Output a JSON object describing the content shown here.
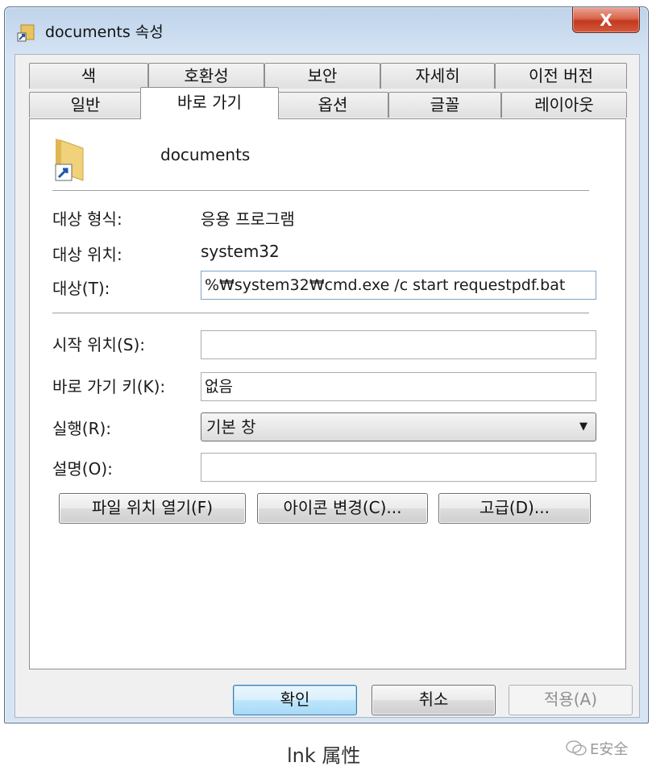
{
  "window": {
    "title": "documents 속성",
    "close_label": "X"
  },
  "tabs_row1": [
    "색",
    "호환성",
    "보안",
    "자세히",
    "이전 버전"
  ],
  "tabs_row2": [
    "일반",
    "바로 가기",
    "옵션",
    "글꼴",
    "레이아웃"
  ],
  "shortcut": {
    "name": "documents",
    "target_type_label": "대상 형식:",
    "target_type_value": "응용 프로그램",
    "target_location_label": "대상 위치:",
    "target_location_value": "system32",
    "target_label": "대상(T):",
    "target_value": "%₩system32₩cmd.exe /c start requestpdf.bat",
    "start_in_label": "시작 위치(S):",
    "start_in_value": "",
    "shortcut_key_label": "바로 가기 키(K):",
    "shortcut_key_value": "없음",
    "run_label": "실행(R):",
    "run_value": "기본 창",
    "comment_label": "설명(O):",
    "comment_value": "",
    "open_location_button": "파일 위치 열기(F)",
    "change_icon_button": "아이콘 변경(C)...",
    "advanced_button": "고급(D)..."
  },
  "footer": {
    "ok": "확인",
    "cancel": "취소",
    "apply": "적용(A)"
  },
  "caption": "lnk 属性",
  "watermark": "E安全",
  "icons": [
    "shortcut-icon",
    "folder-shortcut-icon",
    "dropdown-arrow-icon",
    "wechat-icon"
  ]
}
